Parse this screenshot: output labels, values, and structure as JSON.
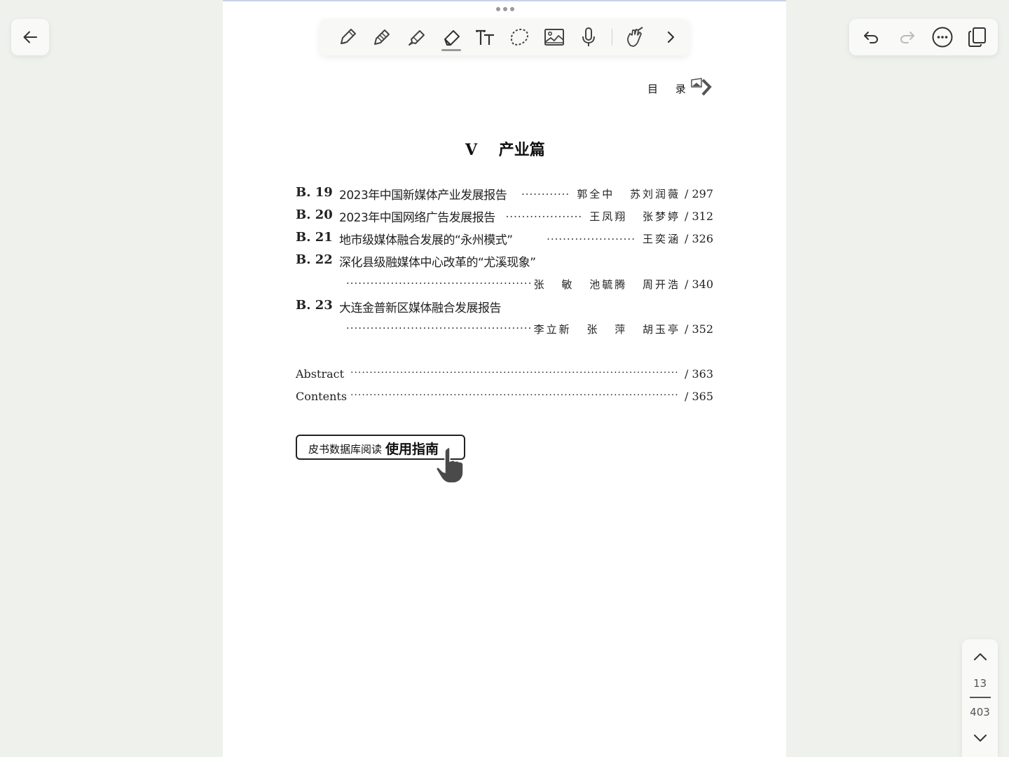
{
  "header": {
    "running_title": "目 录"
  },
  "section": {
    "title": "V    产业篇"
  },
  "toc": [
    {
      "code": "B. 19",
      "title": "2023年中国新媒体产业发展报告",
      "dots": "············",
      "authors": "郭全中 苏刘润薇",
      "page": "/ 297"
    },
    {
      "code": "B. 20",
      "title": "2023年中国网络广告发展报告",
      "dots": "···················",
      "authors": "王凤翔 张梦婷",
      "page": "/ 312"
    },
    {
      "code": "B. 21",
      "title": "地市级媒体融合发展的“永州模式”",
      "dots": "······················",
      "authors": "王奕涵",
      "page": "/ 326"
    },
    {
      "code": "B. 22",
      "title": "深化县级融媒体中心改革的“尤溪现象”",
      "dots": "··············································",
      "authors": "张 敏 池毓腾 周开浩",
      "page": "/ 340"
    },
    {
      "code": "B. 23",
      "title": "大连金普新区媒体融合发展报告",
      "dots": "··············································",
      "authors": "李立新 张 萍 胡玉亭",
      "page": "/ 352"
    }
  ],
  "back_matter": [
    {
      "label": "Abstract",
      "dots": "·······················································································",
      "page": "/ 363"
    },
    {
      "label": "Contents",
      "dots": "·······················································································",
      "page": "/ 365"
    }
  ],
  "guide": {
    "small": "皮书数据库阅读",
    "big": "使用指南"
  },
  "pager": {
    "current": "13",
    "total": "403"
  },
  "toolbar": {
    "tools": [
      "pen-icon",
      "pencil-icon",
      "highlighter-icon",
      "eraser-icon",
      "text-icon",
      "lasso-icon",
      "image-icon",
      "microphone-icon",
      "hand-draw-icon",
      "chevron-right-icon"
    ],
    "active_tool": "eraser-icon"
  },
  "colors": {
    "background": "#eef1ec",
    "page": "#ffffff",
    "eraser_pink": "#f3b7c3"
  }
}
